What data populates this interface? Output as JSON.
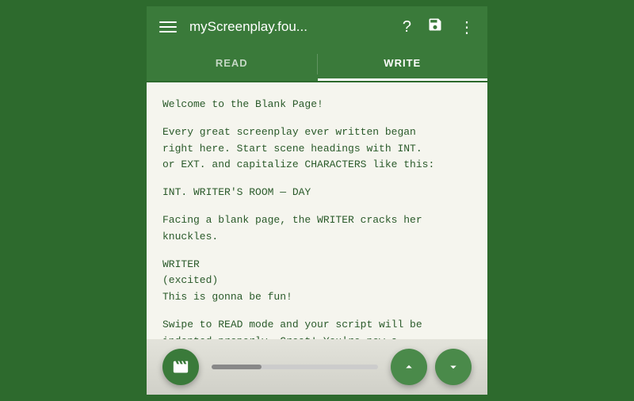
{
  "topbar": {
    "title": "myScreenplay.fou...",
    "help_icon": "?",
    "save_icon": "💾",
    "more_icon": "⋮"
  },
  "tabs": {
    "read_label": "READ",
    "write_label": "WRITE",
    "active": "write"
  },
  "screenplay": {
    "line1": "Welcome to the Blank Page!",
    "line2": "Every great screenplay ever written began\nright here. Start scene headings with INT.\nor EXT. and capitalize CHARACTERS like this:",
    "line3": "INT. WRITER'S ROOM — DAY",
    "line4": "Facing a blank page, the WRITER cracks her\nknuckles.",
    "line5": "WRITER\n(excited)\nThis is gonna be fun!",
    "line6": "Swipe to READ mode and your script will be\nindented properly. Great! You're now a\nscreenplay-formatting expert! For more\nwriting tips, check the side drawer."
  },
  "bottombar": {
    "film_icon": "🎬",
    "up_arrow": "∧",
    "down_arrow": "∨"
  }
}
